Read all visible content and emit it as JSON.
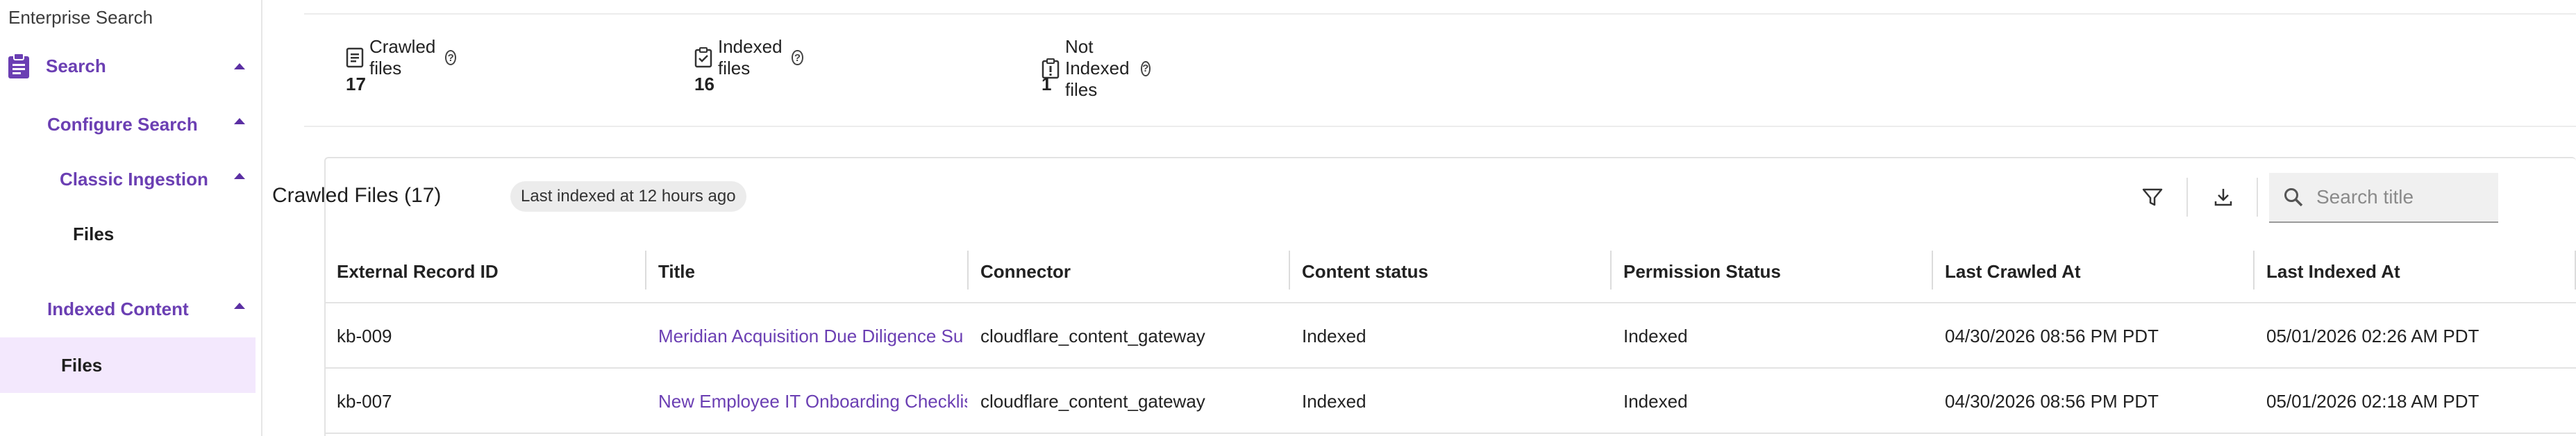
{
  "app": {
    "title": "Enterprise Search"
  },
  "sidebar": {
    "search": "Search",
    "configure_search": "Configure Search",
    "classic_ingestion": "Classic Ingestion",
    "files_1": "Files",
    "indexed_content": "Indexed Content",
    "files_2": "Files"
  },
  "stats": {
    "crawled": {
      "label": "Crawled files",
      "value": "17"
    },
    "indexed": {
      "label": "Indexed files",
      "value": "16"
    },
    "not_indexed": {
      "label": "Not Indexed files",
      "value": "1"
    },
    "help_glyph": "?"
  },
  "card": {
    "title": "Crawled Files (17)",
    "chip": "Last indexed at 12 hours ago",
    "search_placeholder": "Search title"
  },
  "table": {
    "columns": [
      "External Record ID",
      "Title",
      "Connector",
      "Content status",
      "Permission Status",
      "Last Crawled At",
      "Last Indexed At"
    ],
    "rows": [
      [
        "kb-009",
        "Meridian Acquisition Due Diligence Su",
        "cloudflare_content_gateway",
        "Indexed",
        "Indexed",
        "04/30/2026 08:56 PM PDT",
        "05/01/2026 02:26 AM PDT"
      ],
      [
        "kb-007",
        "New Employee IT Onboarding Checklis",
        "cloudflare_content_gateway",
        "Indexed",
        "Indexed",
        "04/30/2026 08:56 PM PDT",
        "05/01/2026 02:18 AM PDT"
      ]
    ]
  },
  "colors": {
    "accent": "#6b3fb3",
    "active_bg": "#f3e8fd"
  },
  "icons": [
    "clipboard-icon",
    "file-text-icon",
    "checked-file-icon",
    "alert-file-icon",
    "help-icon",
    "filter-icon",
    "download-icon",
    "search-icon",
    "caret-up-icon"
  ]
}
